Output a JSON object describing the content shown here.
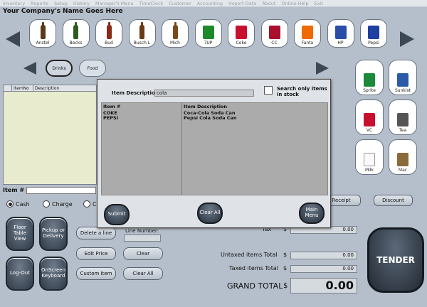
{
  "menu": [
    "Inventory",
    "Reports",
    "Setup",
    "History",
    "Manager's Menu",
    "TimeClock",
    "Customer",
    "Accounting",
    "Import Data",
    "About",
    "Online-Help",
    "Exit"
  ],
  "company_name": "Your Company's Name Goes Here",
  "products_top": [
    {
      "label": "Anstel",
      "icon": "beer-bottle-icon",
      "color": "#5a3a1a"
    },
    {
      "label": "Becks",
      "icon": "beer-bottle-icon",
      "color": "#2f5a24"
    },
    {
      "label": "Bud",
      "icon": "beer-bottle-icon",
      "color": "#8a2a18"
    },
    {
      "label": "Busch L",
      "icon": "beer-bottle-icon",
      "color": "#6a3a14"
    },
    {
      "label": "Mich",
      "icon": "beer-bottle-icon",
      "color": "#7a4a1a"
    },
    {
      "label": "7UP",
      "icon": "7up-logo-icon",
      "color": "#1c8a2a"
    },
    {
      "label": "Coke",
      "icon": "coke-can-icon",
      "color": "#c8102e"
    },
    {
      "label": "CC",
      "icon": "coke-can-icon",
      "color": "#a8102e"
    },
    {
      "label": "Fanta",
      "icon": "fanta-can-icon",
      "color": "#ef6a00"
    },
    {
      "label": "HP",
      "icon": "soda-can-icon",
      "color": "#2a4ea8"
    },
    {
      "label": "Pepsi",
      "icon": "pepsi-can-icon",
      "color": "#1d3fa0"
    }
  ],
  "products_side": [
    {
      "label": "Sprite",
      "icon": "sprite-logo-icon",
      "color": "#1b8a3a"
    },
    {
      "label": "Sunkist",
      "icon": "sunkist-logo-icon",
      "color": "#2a5aa8"
    },
    {
      "label": "VC",
      "icon": "vc-can-icon",
      "color": "#c8102e"
    },
    {
      "label": "Tea",
      "icon": "tea-cup-icon",
      "color": "#555555"
    },
    {
      "label": "Milk",
      "icon": "milk-glass-icon",
      "color": "#eeeeee"
    },
    {
      "label": "Mac",
      "icon": "coffee-cup-icon",
      "color": "#8a6a3a"
    }
  ],
  "categories": [
    {
      "label": "Drinks",
      "selected": true
    },
    {
      "label": "Food",
      "selected": false
    }
  ],
  "order_table": {
    "headers": [
      "ItemNo",
      "Description"
    ]
  },
  "item_label": "Item #",
  "order_type": [
    {
      "label": "Cash",
      "selected": true
    },
    {
      "label": "Charge",
      "selected": false
    },
    {
      "label": "C",
      "selected": false
    }
  ],
  "left_buttons": [
    {
      "label": "Floor Table View"
    },
    {
      "label": "Pickup or Delivery"
    },
    {
      "label": "Log-Out"
    },
    {
      "label": "OnScreen Keyboard"
    }
  ],
  "mid_buttons": {
    "delete": "Delete a line",
    "edit": "Edit Price",
    "custom": "Custom Item",
    "clear": "Clear",
    "clear_all": "Clear All",
    "line_number": "Line Number:"
  },
  "receipt": "Receipt",
  "discount": "Discount",
  "totals": {
    "tax_label": "Tax",
    "tax": "0.00",
    "untaxed_label": "Untaxed items Total",
    "untaxed": "0.00",
    "taxed_label": "Taxed items Total",
    "taxed": "0.00",
    "grand_label": "GRAND TOTAL",
    "grand": "0.00",
    "currency": "$"
  },
  "tender": "TENDER",
  "dialog": {
    "search_label": "Item Description",
    "search_value": "cola",
    "only_in_stock": "Search only items in stock",
    "col1": "Item #",
    "col2": "Item Description",
    "rows": [
      {
        "item": "COKE",
        "desc": "Coca-Cola Soda Can"
      },
      {
        "item": "PEPSI",
        "desc": "Pepsi Cola Soda Can"
      }
    ],
    "submit": "Submit",
    "clear_all": "Clear All",
    "main_menu": "Main Menu"
  }
}
